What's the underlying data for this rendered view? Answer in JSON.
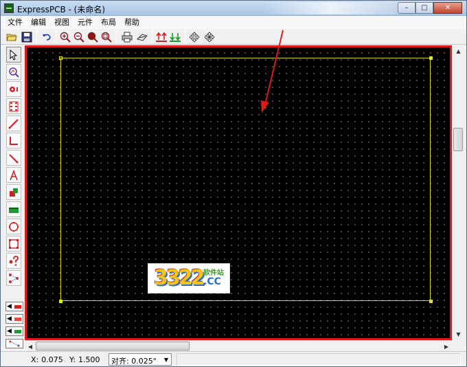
{
  "window": {
    "title": "ExpressPCB - (未命名)",
    "buttons": {
      "minimize": "–",
      "maximize": "□",
      "close": "✕"
    }
  },
  "menu": [
    "文件",
    "编辑",
    "视图",
    "元件",
    "布局",
    "帮助"
  ],
  "toolbar": {
    "items": [
      {
        "name": "open-icon"
      },
      {
        "name": "save-icon"
      },
      {
        "name": "undo-icon"
      },
      {
        "name": "zoom-in-icon"
      },
      {
        "name": "zoom-out-icon"
      },
      {
        "name": "zoom-fit-icon"
      },
      {
        "name": "zoom-window-icon"
      },
      {
        "name": "print-icon"
      },
      {
        "name": "send-icon"
      },
      {
        "name": "layer-top-icon"
      },
      {
        "name": "layer-bottom-icon"
      },
      {
        "name": "move-icon"
      },
      {
        "name": "move-grid-icon"
      }
    ]
  },
  "palette": {
    "tools": [
      "select-icon",
      "zoom-tool-icon",
      "pad-icon",
      "component-icon",
      "trace-icon",
      "trace-corner-icon",
      "trace-diagonal-icon",
      "text-icon",
      "fill-icon",
      "plane-icon",
      "circle-icon",
      "rectangle-icon",
      "query-icon",
      "netlist-icon"
    ],
    "layer_buttons": [
      "layer-top-copper-icon",
      "layer-bottom-copper-icon",
      "layer-silkscreen-icon",
      "layer-ratsnest-icon"
    ]
  },
  "colors": {
    "canvas": "#000000",
    "grid_dot": "#7f7f7f",
    "board_outline": "#d8d820",
    "canvas_highlight": "#e01a1a",
    "annotation_arrow": "#e01a1a"
  },
  "status": {
    "x_label": "X:",
    "x_value": "0.075",
    "y_label": "Y:",
    "y_value": "1.500",
    "snap": "对齐: 0.025\""
  },
  "watermark": {
    "number": "3322",
    "tagline": "软件站",
    "domain": ".CC"
  }
}
